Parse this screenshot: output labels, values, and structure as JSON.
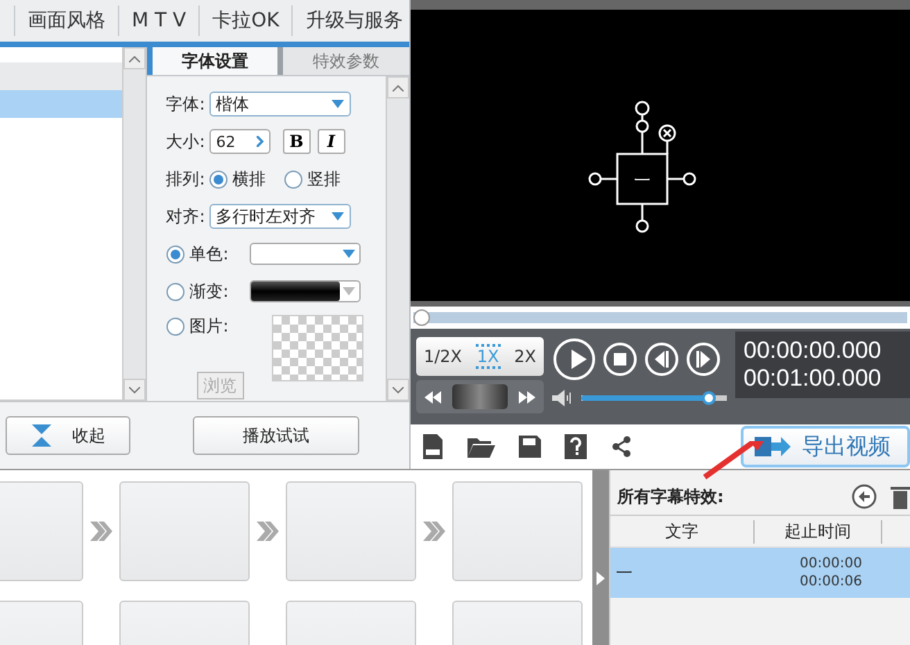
{
  "menu_tabs": [
    "画面风格",
    "M T V",
    "卡拉OK",
    "升级与服务"
  ],
  "left_list": {
    "rows": [
      {
        "selected": false
      },
      {
        "selected": true
      }
    ]
  },
  "settings": {
    "tabs": [
      {
        "label": "字体设置",
        "selected": true
      },
      {
        "label": "特效参数",
        "selected": false
      }
    ],
    "font_label": "字体:",
    "font_value": "楷体",
    "size_label": "大小:",
    "size_value": "62",
    "bold": "B",
    "italic": "I",
    "arrange_label": "排列:",
    "arrange_options": [
      {
        "label": "横排",
        "selected": true
      },
      {
        "label": "竖排",
        "selected": false
      }
    ],
    "align_label": "对齐:",
    "align_value": "多行时左对齐",
    "fill_options": [
      {
        "kind": "solid",
        "label": "单色:",
        "selected": true
      },
      {
        "kind": "gradient",
        "label": "渐变:",
        "selected": false
      },
      {
        "kind": "image",
        "label": "图片:",
        "selected": false
      }
    ],
    "browse": {
      "label": "浏览",
      "disabled": true
    }
  },
  "collapse_button": "收起",
  "preview_button": "播放试试",
  "preview": {
    "caption": "一"
  },
  "progress": {
    "level": 0
  },
  "speeds": [
    {
      "label": "1/2X",
      "selected": false
    },
    {
      "label": "1X",
      "selected": true
    },
    {
      "label": "2X",
      "selected": false
    }
  ],
  "volume": {
    "level": 0.92
  },
  "time_current": "00:00:00.000",
  "time_total": "00:01:00.000",
  "export_button": "导出视频",
  "subtitles": {
    "title": "所有字幕特效:",
    "columns": [
      "文字",
      "起止时间"
    ],
    "rows": [
      {
        "text": "一",
        "start": "00:00:00",
        "end": "00:00:06",
        "selected": true
      }
    ]
  }
}
